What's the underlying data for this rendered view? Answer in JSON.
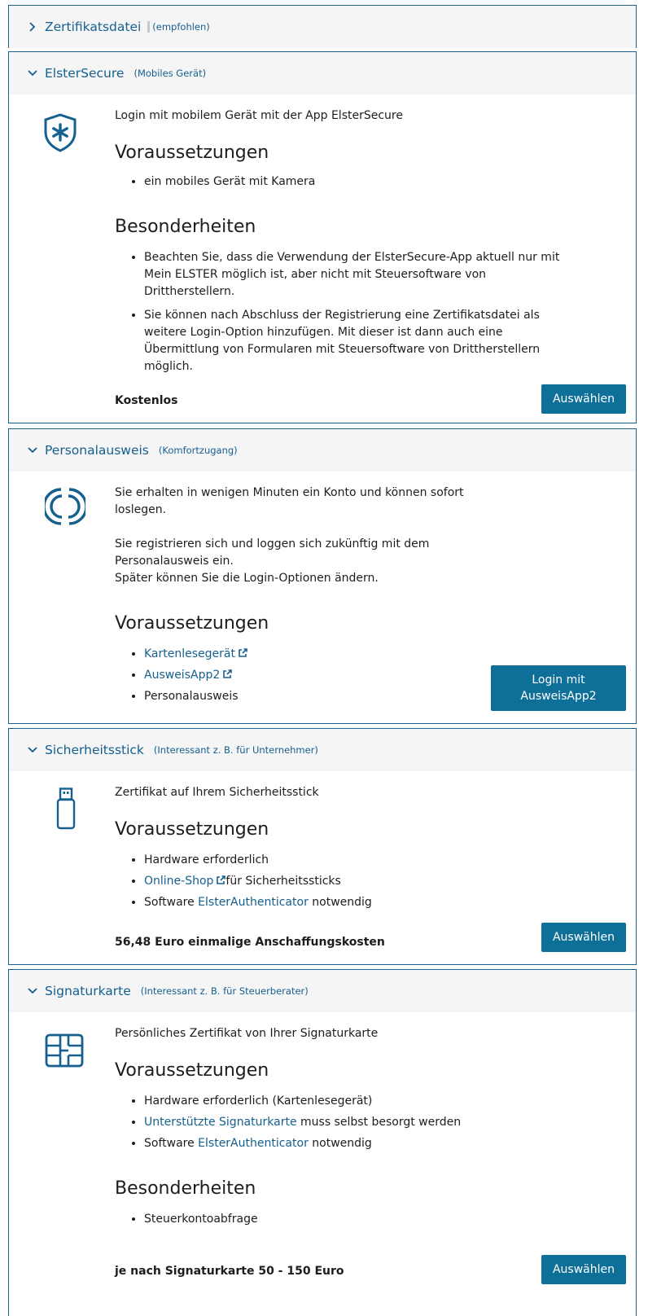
{
  "panels": {
    "zertifikat": {
      "title": "Zertifikatsdatei",
      "sub": "(empfohlen)"
    },
    "elstersecure": {
      "title": "ElsterSecure",
      "sub": "(Mobiles Gerät)",
      "intro": "Login mit mobilem Gerät mit der App ElsterSecure",
      "req_heading": "Voraussetzungen",
      "req": [
        "ein mobiles Gerät mit Kamera"
      ],
      "spec_heading": "Besonderheiten",
      "spec": [
        "Beachten Sie, dass die Verwendung der ElsterSecure-App aktuell nur mit Mein ELSTER möglich ist, aber nicht mit Steuersoftware von Drittherstellern.",
        "Sie können nach Abschluss der Registrierung eine Zertifikatsdatei als weitere Login-Option hinzufügen. Mit dieser ist dann auch eine Übermittlung von Formularen mit Steuersoftware von Drittherstellern möglich."
      ],
      "price": "Kostenlos",
      "button": "Auswählen"
    },
    "personalausweis": {
      "title": "Personalausweis",
      "sub": "(Komfortzugang)",
      "intro1": "Sie erhalten in wenigen Minuten ein Konto und können sofort loslegen.",
      "intro2a": "Sie registrieren sich und loggen sich zukünftig mit dem Personalausweis ein.",
      "intro2b": "Später können Sie die Login-Optionen ändern.",
      "req_heading": "Voraussetzungen",
      "req_link1": "Kartenlesegerät",
      "req_link2": "AusweisApp2",
      "req3": "Personalausweis",
      "button": "Login mit AusweisApp2"
    },
    "stick": {
      "title": "Sicherheitsstick",
      "sub": "(Interessant z. B. für Unternehmer)",
      "intro": "Zertifikat auf Ihrem Sicherheitsstick",
      "req_heading": "Voraussetzungen",
      "req1": "Hardware erforderlich",
      "req2_link": "Online-Shop",
      "req2_rest": "für Sicherheitssticks",
      "req3_pre": "Software ",
      "req3_link": "ElsterAuthenticator",
      "req3_post": " notwendig",
      "price": "56,48 Euro einmalige Anschaffungskosten",
      "button": "Auswählen"
    },
    "signatur": {
      "title": "Signaturkarte",
      "sub": "(Interessant z. B. für Steuerberater)",
      "intro": "Persönliches Zertifikat von Ihrer Signaturkarte",
      "req_heading": "Voraussetzungen",
      "req1": "Hardware erforderlich (Kartenlesegerät)",
      "req2_link": "Unterstützte Signaturkarte",
      "req2_rest": " muss selbst besorgt werden",
      "req3_pre": "Software ",
      "req3_link": "ElsterAuthenticator",
      "req3_post": " notwendig",
      "spec_heading": "Besonderheiten",
      "spec1": "Steuerkontoabfrage",
      "price": "je nach Signaturkarte 50 - 150 Euro",
      "button": "Auswählen"
    }
  }
}
